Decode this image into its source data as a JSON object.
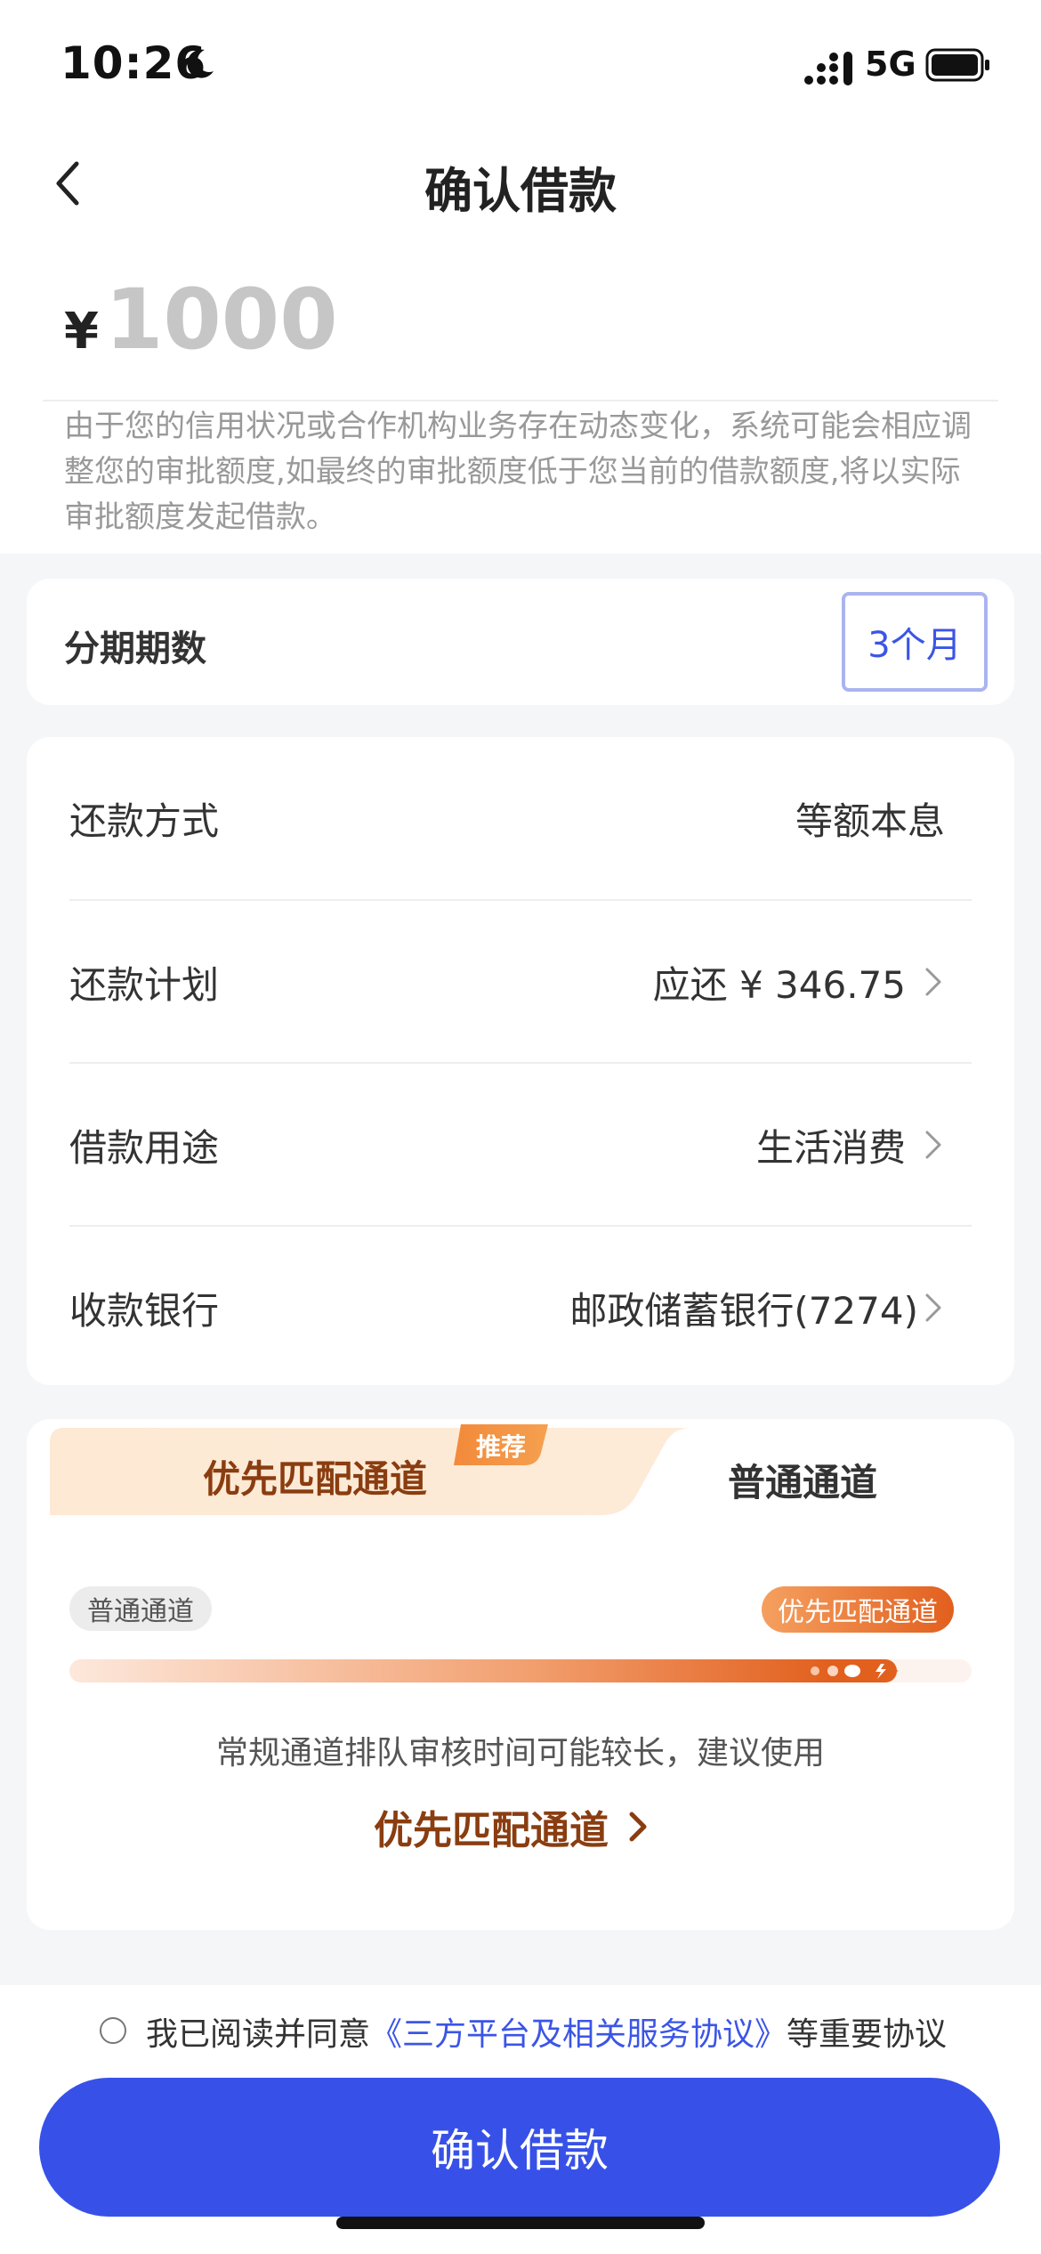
{
  "status_bar": {
    "time": "10:26",
    "network": "5G"
  },
  "nav": {
    "title": "确认借款"
  },
  "amount": {
    "currency": "¥",
    "value": "1000",
    "notice": "由于您的信用状况或合作机构业务存在动态变化，系统可能会相应调整您的审批额度,如最终的审批额度低于您当前的借款额度,将以实际审批额度发起借款。"
  },
  "term": {
    "label": "分期期数",
    "value": "3个月"
  },
  "rows": [
    {
      "label": "还款方式",
      "value": "等额本息"
    },
    {
      "label": "还款计划",
      "value": "应还 ¥ 346.75"
    },
    {
      "label": "借款用途",
      "value": "生活消费"
    },
    {
      "label": "收款银行",
      "value": "邮政储蓄银行(7274)"
    }
  ],
  "channel": {
    "tab_priority": "优先匹配通道",
    "tab_badge": "推荐",
    "tab_normal": "普通通道",
    "pill_normal": "普通通道",
    "pill_priority": "优先匹配通道",
    "hint": "常规通道排队审核时间可能较长，建议使用",
    "cta": "优先匹配通道"
  },
  "agreement": {
    "prefix": "我已阅读并同意",
    "link": "《三方平台及相关服务协议》",
    "suffix": "等重要协议"
  },
  "confirm_button": "确认借款",
  "colors": {
    "primary": "#3751e8",
    "accent_orange": "#e25f1e",
    "brown": "#8a3d10"
  }
}
